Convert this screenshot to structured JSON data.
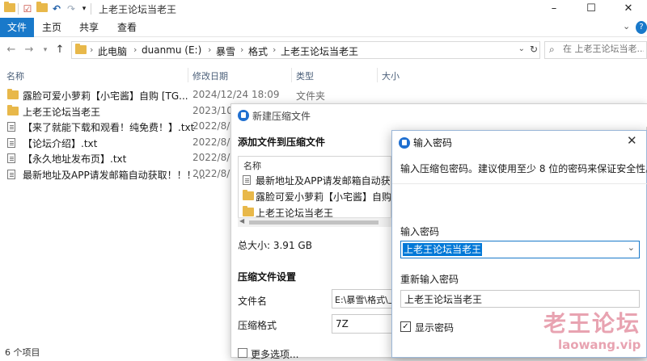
{
  "window": {
    "title": "上老王论坛当老王",
    "controls": {
      "minimize": "–",
      "maximize": "☐",
      "close": "✕"
    }
  },
  "ribbon": {
    "tabs": [
      "文件",
      "主页",
      "共享",
      "查看"
    ]
  },
  "address_bar": {
    "crumbs": [
      "此电脑",
      "duanmu (E:)",
      "暴雪",
      "格式",
      "上老王论坛当老王"
    ],
    "search_placeholder": "在 上老王论坛当老..."
  },
  "file_list": {
    "columns": [
      "名称",
      "修改日期",
      "类型",
      "大小"
    ],
    "rows": [
      {
        "name": "露脸可爱小萝莉【小宅酱】自购 [TG...",
        "date": "2024/12/24 18:09",
        "type": "文件夹",
        "icon": "folder-icon"
      },
      {
        "name": "上老王论坛当老王",
        "date": "2023/10/",
        "type": "",
        "icon": "folder-icon"
      },
      {
        "name": "【来了就能下载和观看！纯免费！】.txt",
        "date": "2022/8/1",
        "type": "",
        "icon": "text-file-icon"
      },
      {
        "name": "【论坛介绍】.txt",
        "date": "2022/8/1",
        "type": "",
        "icon": "text-file-icon"
      },
      {
        "name": "【永久地址发布页】.txt",
        "date": "2022/8/1",
        "type": "",
        "icon": "text-file-icon"
      },
      {
        "name": "最新地址及APP请发邮箱自动获取！！！...",
        "date": "2022/8/1",
        "type": "",
        "icon": "text-file-icon"
      }
    ],
    "status": "6 个项目"
  },
  "compress_dialog": {
    "title": "新建压缩文件",
    "add_heading": "添加文件到压缩文件",
    "list_header": "名称",
    "list_items": [
      {
        "text": "最新地址及APP请发邮箱自动获取！",
        "icon": "text-file-icon"
      },
      {
        "text": "露脸可爱小萝莉【小宅酱】自购 [",
        "icon": "folder-icon"
      },
      {
        "text": "上老王论坛当老王",
        "icon": "folder-icon"
      }
    ],
    "total_size": "总大小: 3.91 GB",
    "settings_heading": "压缩文件设置",
    "filename_label": "文件名",
    "filename_value": "E:\\暴雪\\格式\\上",
    "format_label": "压缩格式",
    "format_value": "7Z",
    "more_options": "更多选项..."
  },
  "password_dialog": {
    "title": "输入密码",
    "hint": "输入压缩包密码。建议使用至少 8 位的密码来保证安全性。",
    "password_label": "输入密码",
    "password_value": "上老王论坛当老王",
    "confirm_label": "重新输入密码",
    "confirm_value": "上老王论坛当老王",
    "show_password_label": "显示密码",
    "show_password_checked": "✓"
  },
  "watermark": {
    "line1": "老王论坛",
    "line2": "laowang.vip"
  }
}
